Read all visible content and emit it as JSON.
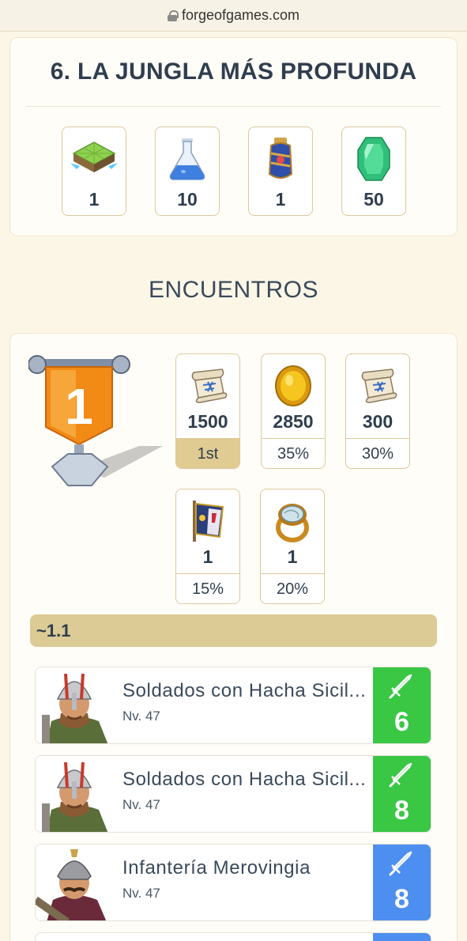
{
  "browser": {
    "url": "forgeofgames.com"
  },
  "level": {
    "title": "6. LA JUNGLA MÁS PROFUNDA",
    "costs": [
      {
        "icon": "land-expansion-icon",
        "value": "1"
      },
      {
        "icon": "research-flask-icon",
        "value": "10"
      },
      {
        "icon": "blue-potion-icon",
        "value": "1"
      },
      {
        "icon": "emerald-gem-icon",
        "value": "50"
      }
    ]
  },
  "encounters": {
    "heading": "ENCUENTROS",
    "trophy_rank": "1",
    "rewards": [
      {
        "icon": "blueprint-scroll-icon",
        "value": "1500",
        "chance": "1st"
      },
      {
        "icon": "gold-coin-icon",
        "value": "2850",
        "chance": "35%"
      },
      {
        "icon": "blueprint-scroll-icon",
        "value": "300",
        "chance": "30%"
      },
      {
        "icon": "banner-flag-icon",
        "value": "1",
        "chance": "15%"
      },
      {
        "icon": "ring-icon",
        "value": "1",
        "chance": "20%"
      }
    ],
    "group_label": "~1.1",
    "units": [
      {
        "name": "Soldados con Hacha Sicil...",
        "level": "Nv. 47",
        "count": "6",
        "badge_color": "#39c744",
        "portrait": "axe-soldier-portrait"
      },
      {
        "name": "Soldados con Hacha Sicil...",
        "level": "Nv. 47",
        "count": "8",
        "badge_color": "#39c744",
        "portrait": "axe-soldier-portrait"
      },
      {
        "name": "Infantería Merovingia",
        "level": "Nv. 47",
        "count": "8",
        "badge_color": "#4d8ff0",
        "portrait": "merovingian-infantry-portrait"
      }
    ]
  }
}
